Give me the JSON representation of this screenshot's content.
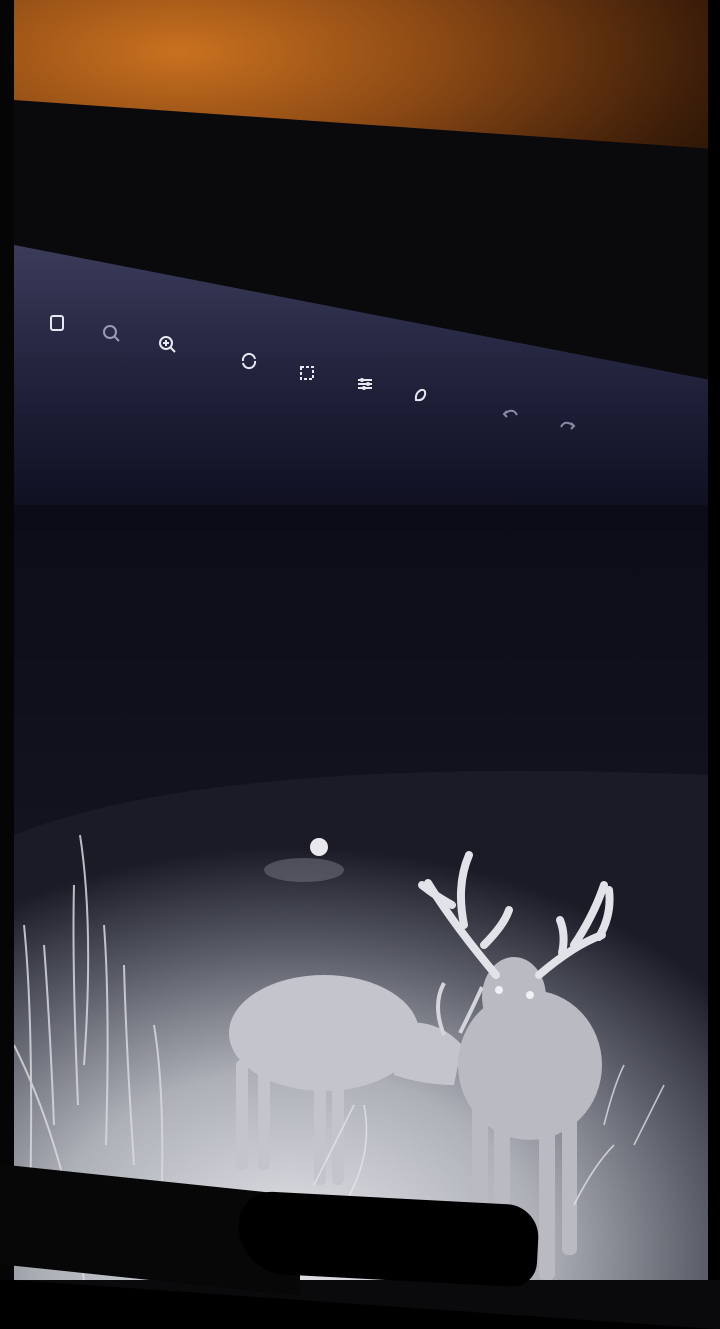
{
  "toolbar": {
    "icons": [
      "rotate-page-icon",
      "zoom-out-icon",
      "zoom-in-icon",
      "rotate-icon",
      "crop-icon",
      "adjust-icon",
      "markup-icon",
      "undo-icon",
      "redo-icon"
    ]
  },
  "colors": {
    "wall": "#8a4814",
    "screen_top": "#3a3c5a",
    "photo_ground": "#cfd0d6"
  }
}
